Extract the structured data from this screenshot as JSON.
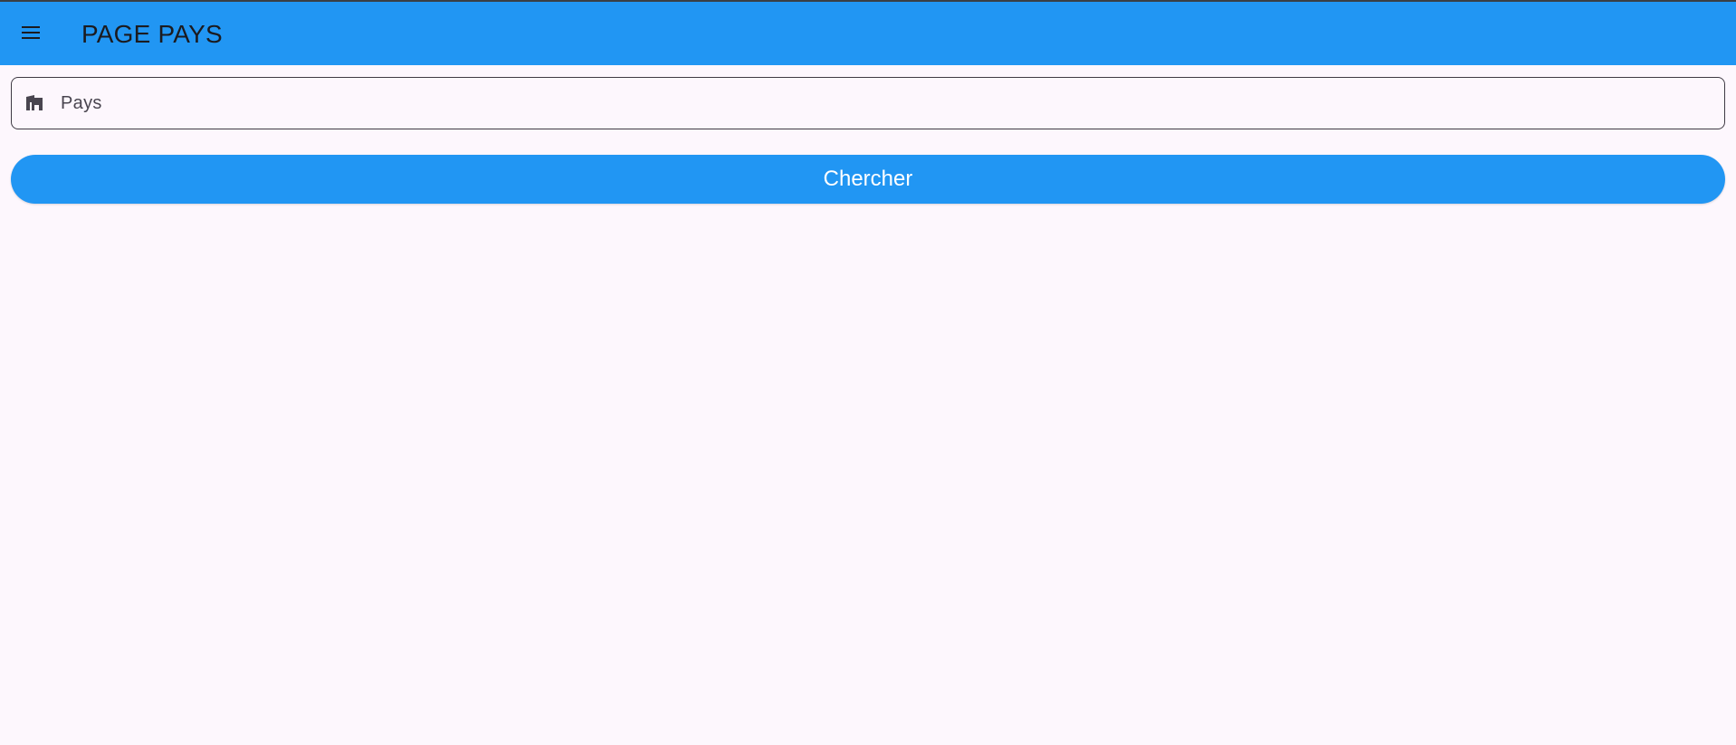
{
  "appbar": {
    "title": "PAGE PAYS",
    "menu_icon": "hamburger-menu-icon",
    "background_color": "#2196f3"
  },
  "search": {
    "icon": "store-icon",
    "placeholder": "Pays",
    "value": ""
  },
  "actions": {
    "search_label": "Chercher"
  },
  "colors": {
    "accent": "#2196f3",
    "background": "#fdf7fd",
    "text": "#1b1b1f"
  }
}
